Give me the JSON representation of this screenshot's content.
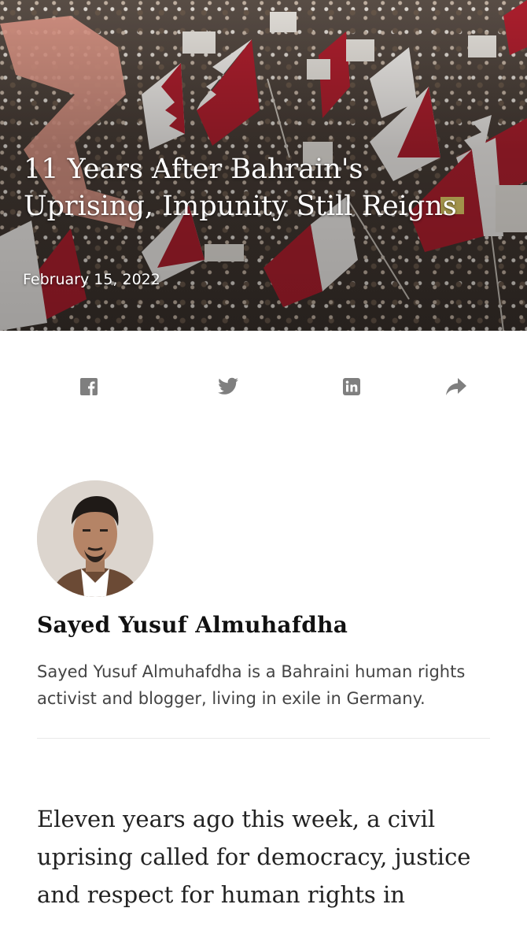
{
  "hero": {
    "title": "11 Years After Bahrain's Uprising, Impunity Still Reigns",
    "date": "February 15, 2022"
  },
  "share": {
    "icons": [
      "facebook-icon",
      "twitter-icon",
      "linkedin-icon",
      "share-arrow-icon"
    ]
  },
  "author": {
    "name": "Sayed Yusuf Almuhafdha",
    "bio": "Sayed Yusuf Almuhafdha is a Bahraini human rights activist and blogger, living in exile in Germany."
  },
  "article": {
    "intro": "Eleven years ago this week, a civil uprising called for democracy, justice and respect for human rights in"
  },
  "colors": {
    "flag_red": "#b3202f",
    "flag_white": "#f4f1ee",
    "icon_gray": "#7f7f7f"
  }
}
